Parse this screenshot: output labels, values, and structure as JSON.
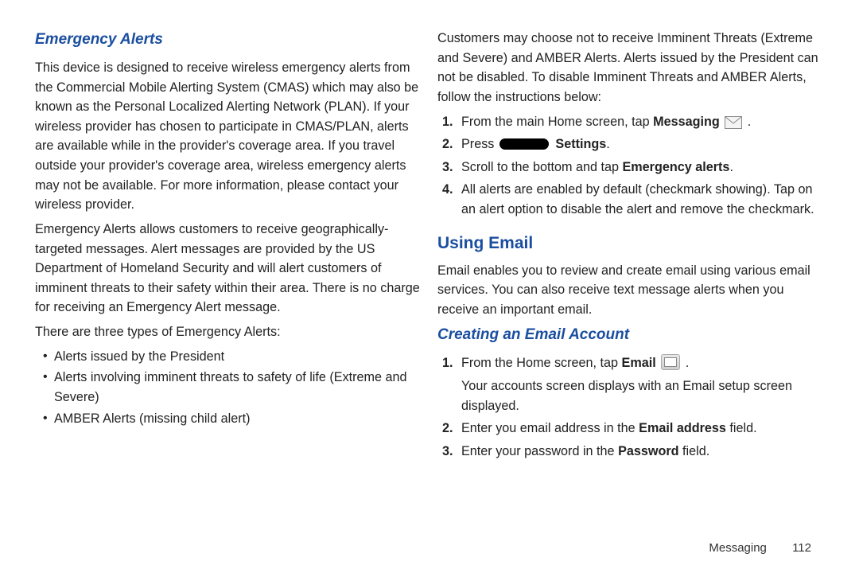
{
  "left": {
    "heading": "Emergency Alerts",
    "p1": "This device is designed to receive wireless emergency alerts from the Commercial Mobile Alerting System (CMAS) which may also be known as the Personal Localized Alerting Network (PLAN). If your wireless provider has chosen to participate in CMAS/PLAN, alerts are available while in the provider's coverage area. If you travel outside your provider's coverage area, wireless emergency alerts may not be available. For more information, please contact your wireless provider.",
    "p2": "Emergency Alerts allows customers to receive geographically-targeted messages. Alert messages are provided by the US Department of Homeland Security and will alert customers of imminent threats to their safety within their area. There is no charge for receiving an Emergency Alert message.",
    "p3": "There are three types of Emergency Alerts:",
    "bullets": [
      "Alerts issued by the President",
      "Alerts involving imminent threats to safety of life (Extreme and Severe)",
      "AMBER Alerts (missing child alert)"
    ]
  },
  "right": {
    "intro": "Customers may choose not to receive Imminent Threats (Extreme and Severe) and AMBER Alerts. Alerts issued by the President can not be disabled. To disable Imminent Threats and AMBER Alerts, follow the instructions below:",
    "steps1": {
      "s1_a": "From the main Home screen, tap ",
      "s1_b": "Messaging",
      "s1_c": " .",
      "s2_a": "Press ",
      "s2_b": "Settings",
      "s2_c": ".",
      "s3_a": "Scroll to the bottom and tap ",
      "s3_b": "Emergency alerts",
      "s3_c": ".",
      "s4": "All alerts are enabled by default (checkmark showing). Tap on an alert option to disable the alert and remove the checkmark."
    },
    "h_email": "Using Email",
    "email_intro": "Email enables you to review and create email using various email services. You can also receive text message alerts when you receive an important email.",
    "h_create": "Creating an Email Account",
    "steps2": {
      "s1_a": "From the Home screen, tap ",
      "s1_b": "Email",
      "s1_c": " .",
      "s1_extra": "Your accounts screen displays with an Email setup screen displayed.",
      "s2_a": "Enter you email address in the ",
      "s2_b": "Email address",
      "s2_c": " field.",
      "s3_a": "Enter your password in the ",
      "s3_b": "Password",
      "s3_c": " field."
    }
  },
  "footer": {
    "section": "Messaging",
    "page": "112"
  }
}
